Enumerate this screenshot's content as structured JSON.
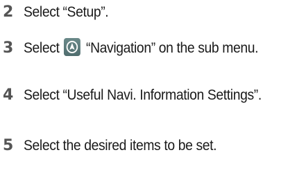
{
  "steps": [
    {
      "number": "2",
      "text": "Select “Setup”."
    },
    {
      "number": "3",
      "text_before_icon": "Select",
      "icon": "navigation-icon",
      "text_after_icon": "“Navigation” on the sub menu."
    },
    {
      "number": "4",
      "text": "Select “Useful Navi. Information Settings”."
    },
    {
      "number": "5",
      "text": "Select the desired items to be set."
    }
  ],
  "colors": {
    "step_number": "#555555",
    "text": "#1a1a1a",
    "icon_background": "#5d7b7c"
  }
}
